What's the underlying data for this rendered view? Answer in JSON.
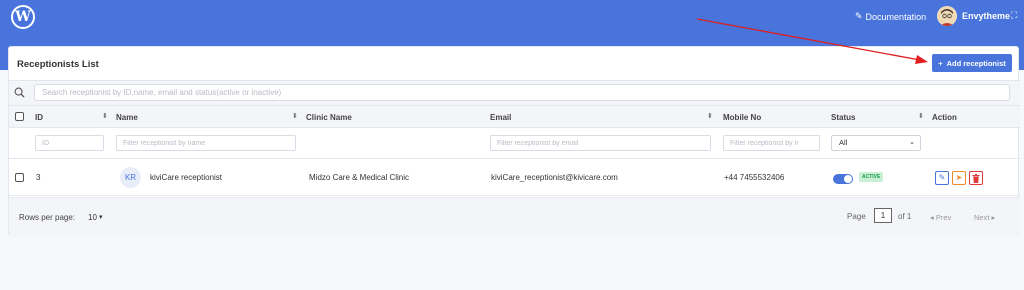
{
  "topbar": {
    "logo_letter": "W",
    "documentation_label": "Documentation",
    "user_name": "Envytheme",
    "expand_icon": "expand-icon",
    "colors": {
      "bar": "#4874dc"
    }
  },
  "card": {
    "title": "Receptionists List",
    "add_button_label": "Add receptionist",
    "add_button_icon": "+"
  },
  "search": {
    "placeholder": "Search receptionist by ID,name, email and status(active or inactive)"
  },
  "table": {
    "columns": [
      {
        "label": "ID"
      },
      {
        "label": "Name"
      },
      {
        "label": "Clinic Name"
      },
      {
        "label": "Email"
      },
      {
        "label": "Mobile No"
      },
      {
        "label": "Status"
      },
      {
        "label": "Action"
      }
    ],
    "filters": {
      "id_placeholder": "ID",
      "name_placeholder": "Filter receptionist by name",
      "email_placeholder": "Filter receptionist by email",
      "mobile_placeholder": "Filter receptionist by n",
      "status_selected": "All"
    },
    "rows": [
      {
        "id": "3",
        "initials": "KR",
        "name": "kiviCare receptionist",
        "clinic": "Midzo Care & Medical Clinic",
        "email": "kiviCare_receptionist@kivicare.com",
        "mobile": "+44 7455532406",
        "status_badge": "ACTIVE",
        "status_on": true
      }
    ]
  },
  "footer": {
    "rows_per_page_label": "Rows per page:",
    "rows_per_page_value": "10",
    "page_label": "Page",
    "page_current": "1",
    "page_of": "of 1",
    "prev_label": "Prev",
    "next_label": "Next"
  },
  "annotation": {
    "arrow_color": "#e01e1e"
  }
}
